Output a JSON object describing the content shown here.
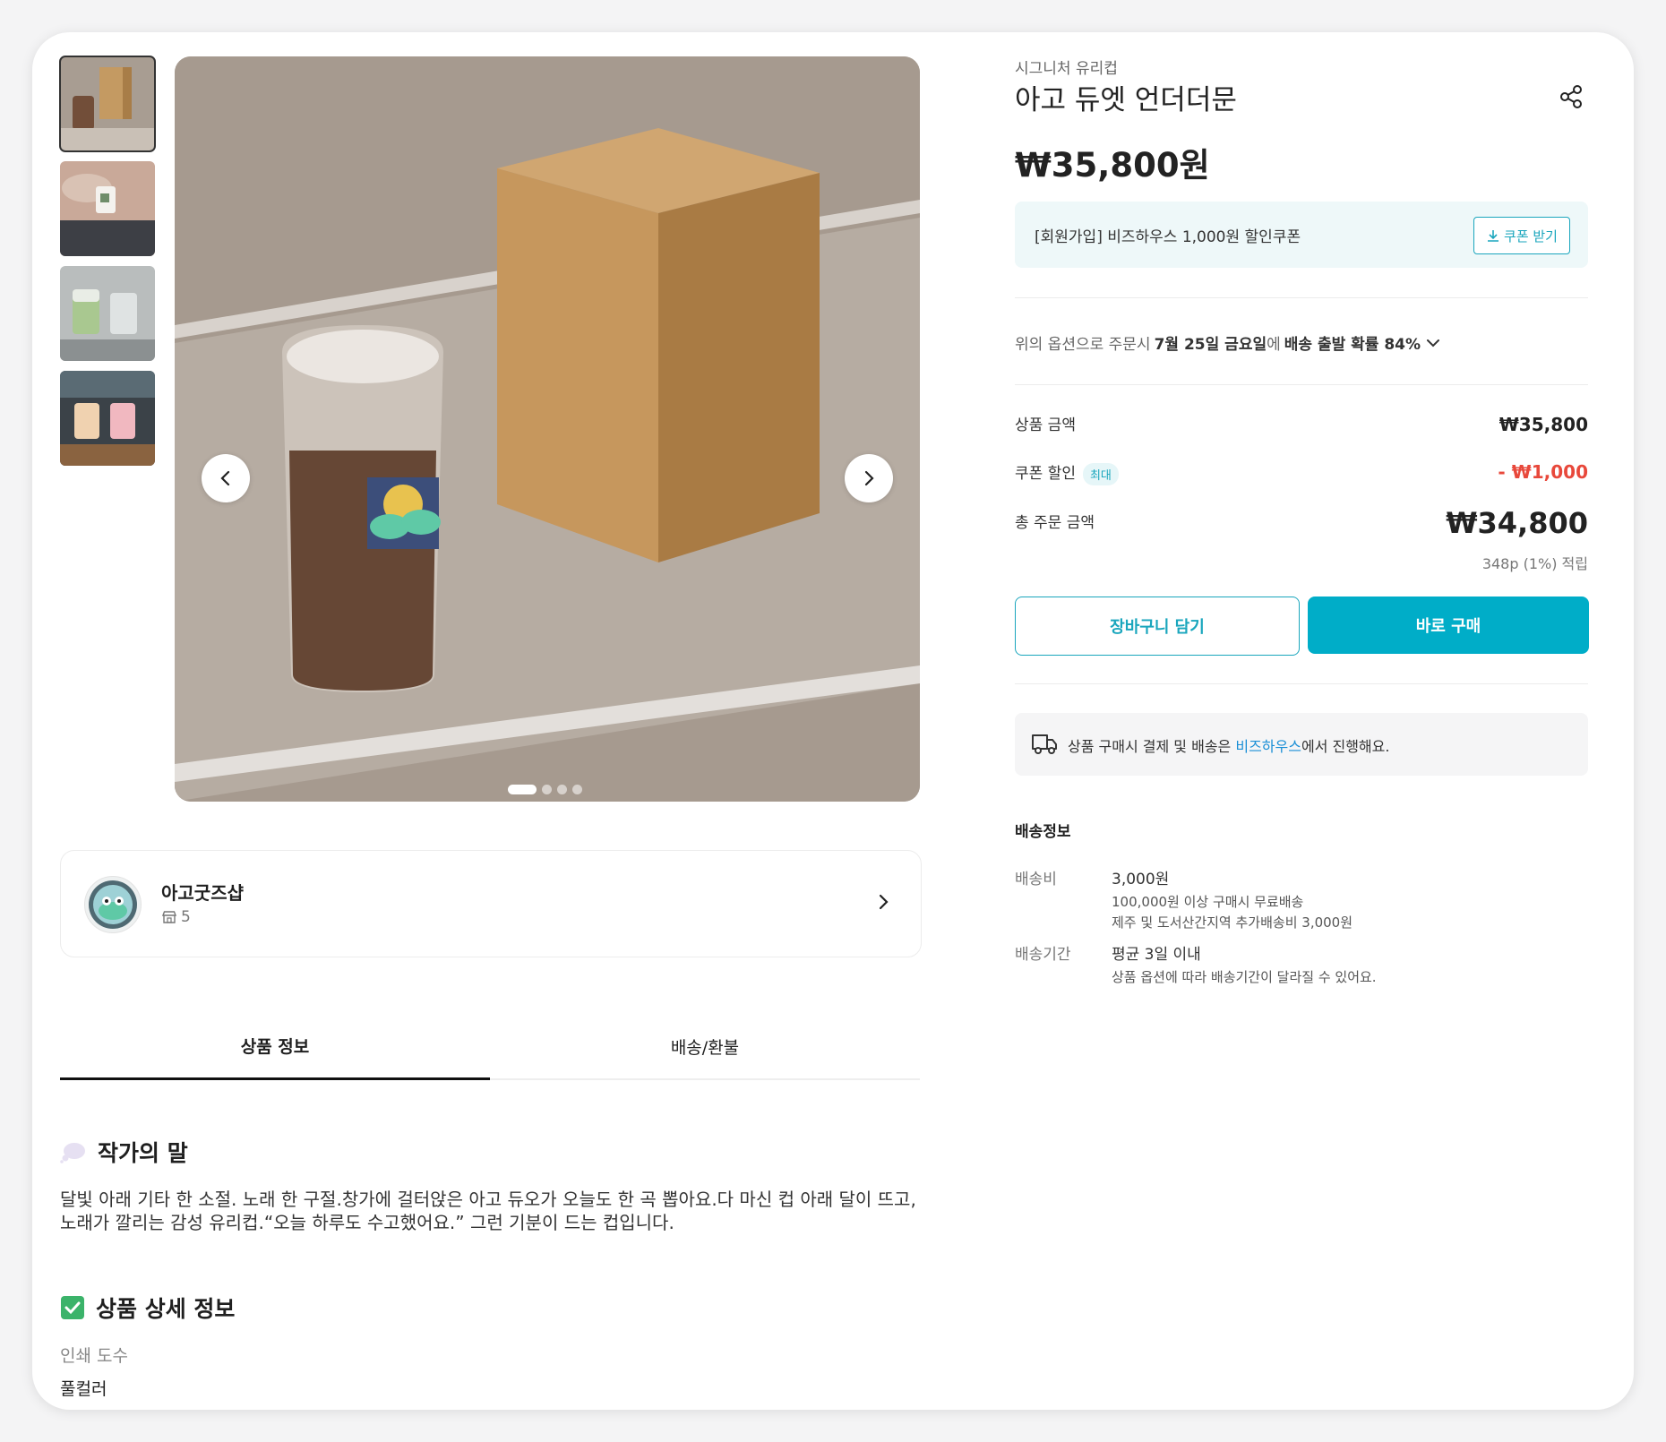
{
  "gallery": {
    "thumbnails": [
      "thumbnail-1",
      "thumbnail-2",
      "thumbnail-3",
      "thumbnail-4"
    ],
    "active_index": 0,
    "slide_count": 4
  },
  "shop": {
    "name": "아고굿즈샵",
    "product_count": "5"
  },
  "tabs": {
    "info": "상품 정보",
    "shipping": "배송/환불"
  },
  "author_note": {
    "title": "작가의 말",
    "body": "달빛 아래 기타 한 소절. 노래 한 구절.창가에 걸터앉은 아고 듀오가 오늘도 한 곡 뽑아요.다 마신 컵 아래 달이 뜨고, 노래가 깔리는 감성 유리컵.“오늘 하루도 수고했어요.” 그런 기분이 드는 컵입니다."
  },
  "detail": {
    "title": "상품 상세 정보",
    "label": "인쇄 도수",
    "value": "풀컬러"
  },
  "product": {
    "category": "시그니처 유리컵",
    "name": "아고 듀엣 언더더문",
    "price": "₩35,800원"
  },
  "coupon": {
    "text": "[회원가입] 비즈하우스 1,000원 할인쿠폰",
    "button": "쿠폰 받기"
  },
  "delivery_estimate": {
    "prefix": "위의 옵션으로 주문시",
    "date": "7월 25일 금요일",
    "middle": "에",
    "probability": "배송 출발 확률 84%"
  },
  "summary": {
    "item_label": "상품 금액",
    "item_value": "₩35,800",
    "discount_label": "쿠폰 할인",
    "discount_badge": "최대",
    "discount_value": "- ₩1,000",
    "total_label": "총 주문 금액",
    "total_value": "₩34,800",
    "points": "348p (1%) 적립"
  },
  "actions": {
    "cart": "장바구니 담기",
    "buy": "바로 구매"
  },
  "notice": {
    "prefix": "상품 구매시 결제 및 배송은 ",
    "link": "비즈하우스",
    "suffix": "에서 진행해요."
  },
  "shipping_info": {
    "title": "배송정보",
    "fee_label": "배송비",
    "fee_value": "3,000원",
    "fee_note1": "100,000원 이상 구매시 무료배송",
    "fee_note2": "제주 및 도서산간지역 추가배송비 3,000원",
    "period_label": "배송기간",
    "period_value": "평균 3일 이내",
    "period_note": "상품 옵션에 따라 배송기간이 달라질 수 있어요."
  },
  "colors": {
    "accent": "#00adc8",
    "discount": "#e8483b",
    "link": "#1a8fd6"
  }
}
